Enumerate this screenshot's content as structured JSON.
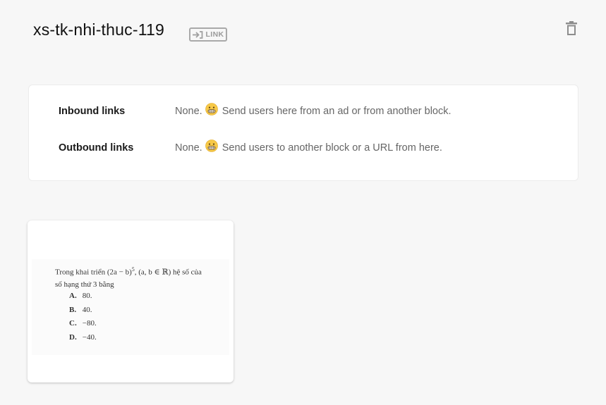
{
  "header": {
    "title": "xs-tk-nhi-thuc-119",
    "badge_label": "LINK"
  },
  "links": {
    "inbound": {
      "label": "Inbound links",
      "none_text": "None.",
      "hint": "Send users here from an ad or from another block.",
      "emoji": "grimacing-face"
    },
    "outbound": {
      "label": "Outbound links",
      "none_text": "None.",
      "hint": "Send users to another block or a URL from here.",
      "emoji": "grimacing-face"
    }
  },
  "preview": {
    "question_prefix": "Trong khai triển (2a − b)",
    "question_exp": "5",
    "question_mid": ", (a, b ∈ ℝ) hệ số của",
    "question_line2": "số hạng thứ 3 bằng",
    "options": [
      {
        "letter": "A.",
        "value": "80."
      },
      {
        "letter": "B.",
        "value": "40."
      },
      {
        "letter": "C.",
        "value": "−80."
      },
      {
        "letter": "D.",
        "value": "−40."
      }
    ]
  },
  "colors": {
    "page_bg": "#f7f7f7",
    "card_bg": "#ffffff",
    "muted_text": "#666666",
    "badge_gray": "#a9a9a9",
    "emoji_yellow": "#f7c948"
  }
}
